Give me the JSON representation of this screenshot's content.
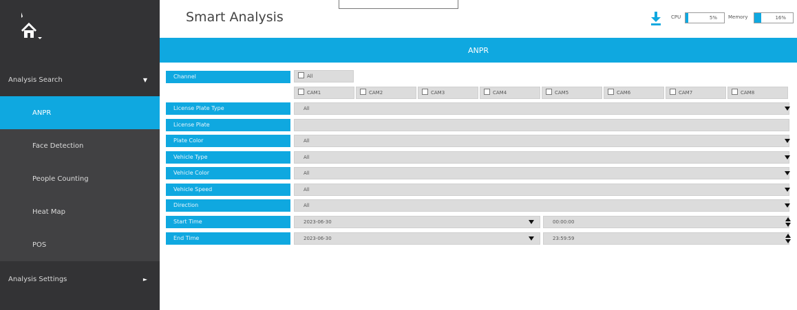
{
  "sidebar": {
    "groups": [
      {
        "label": "Analysis Search",
        "arrow": "▼"
      },
      {
        "label": "Analysis Settings",
        "arrow": "►"
      }
    ],
    "items": [
      {
        "label": "ANPR",
        "active": true
      },
      {
        "label": "Face Detection",
        "active": false
      },
      {
        "label": "People Counting",
        "active": false
      },
      {
        "label": "Heat Map",
        "active": false
      },
      {
        "label": "POS",
        "active": false
      }
    ]
  },
  "header": {
    "title": "Smart Analysis",
    "cpu_label": "CPU",
    "cpu_value": "5%",
    "memory_label": "Memory",
    "memory_value": "16%"
  },
  "banner": {
    "title": "ANPR"
  },
  "form": {
    "channel": {
      "label": "Channel",
      "all_label": "All",
      "cameras": [
        "CAM1",
        "CAM2",
        "CAM3",
        "CAM4",
        "CAM5",
        "CAM6",
        "CAM7",
        "CAM8"
      ]
    },
    "license_plate_type": {
      "label": "License Plate Type",
      "value": "All"
    },
    "license_plate": {
      "label": "License Plate",
      "value": ""
    },
    "plate_color": {
      "label": "Plate Color",
      "value": "All"
    },
    "vehicle_type": {
      "label": "Vehicle Type",
      "value": "All"
    },
    "vehicle_color": {
      "label": "Vehicle Color",
      "value": "All"
    },
    "vehicle_speed": {
      "label": "Vehicle Speed",
      "value": "All"
    },
    "direction": {
      "label": "Direction",
      "value": "All"
    },
    "start_time": {
      "label": "Start Time",
      "date": "2023-06-30",
      "time": "00:00:00"
    },
    "end_time": {
      "label": "End Time",
      "date": "2023-06-30",
      "time": "23:59:59"
    }
  },
  "colors": {
    "accent": "#0fa8e0",
    "sidebar_bg": "#333335",
    "sub_item_bg": "#414143",
    "field_bg": "#dcdcdc"
  },
  "icons": [
    "home-icon",
    "download-icon",
    "dropdown-arrow-icon",
    "spinner-arrows-icon",
    "checkbox-icon"
  ]
}
